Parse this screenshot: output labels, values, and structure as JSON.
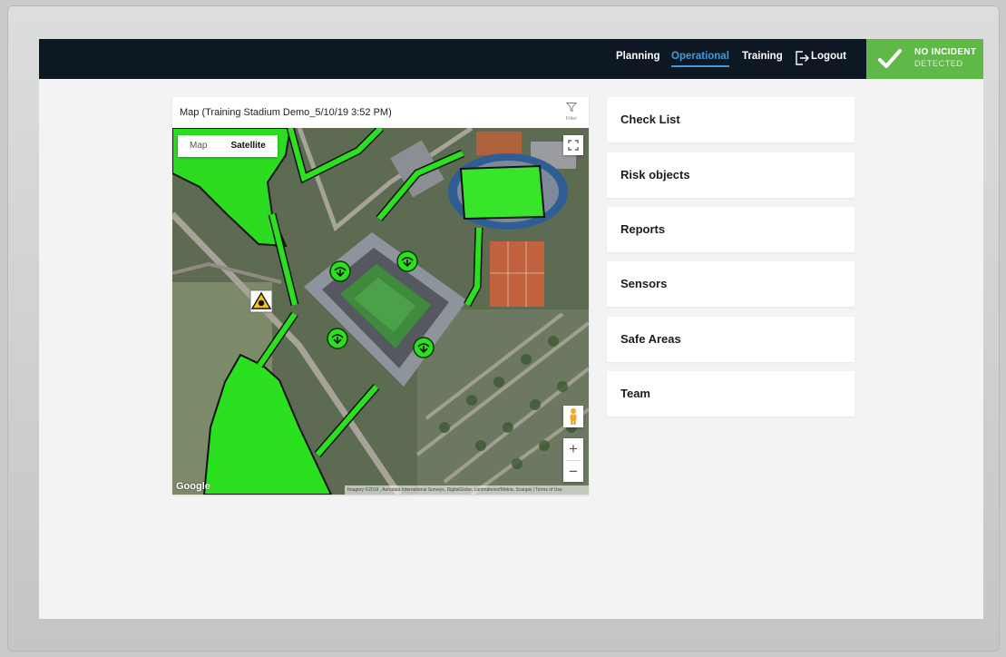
{
  "nav": {
    "items": [
      {
        "label": "Planning",
        "active": false
      },
      {
        "label": "Operational",
        "active": true
      },
      {
        "label": "Training",
        "active": false
      }
    ],
    "logout_label": "Logout",
    "logout_icon": "logout-icon"
  },
  "status": {
    "line1": "NO INCIDENT",
    "line2": "DETECTED",
    "color": "#5fb847",
    "icon": "check-icon"
  },
  "map": {
    "title": "Map (Training Stadium Demo_5/10/19 3:52 PM)",
    "filter_label": "Filter",
    "maptype_options": [
      "Map",
      "Satellite"
    ],
    "maptype_selected": "Satellite",
    "zoom_in": "+",
    "zoom_out": "−",
    "logo": "Google",
    "attribution": "Imagery ©2019 , Aerodata International Surveys, DigitalGlobe, Lantmäteriet/Metria, Scanpix | Terms of Use",
    "safe_area_color": "#29e01f",
    "markers": [
      "sensor-icon",
      "sensor-icon",
      "sensor-icon",
      "sensor-icon",
      "hazard-icon"
    ]
  },
  "menu": [
    {
      "label": "Check List"
    },
    {
      "label": "Risk objects"
    },
    {
      "label": "Reports"
    },
    {
      "label": "Sensors"
    },
    {
      "label": "Safe Areas"
    },
    {
      "label": "Team"
    }
  ],
  "colors": {
    "topbar": "#0e1822",
    "accent": "#3f9be4",
    "background": "#f3f3f3"
  }
}
